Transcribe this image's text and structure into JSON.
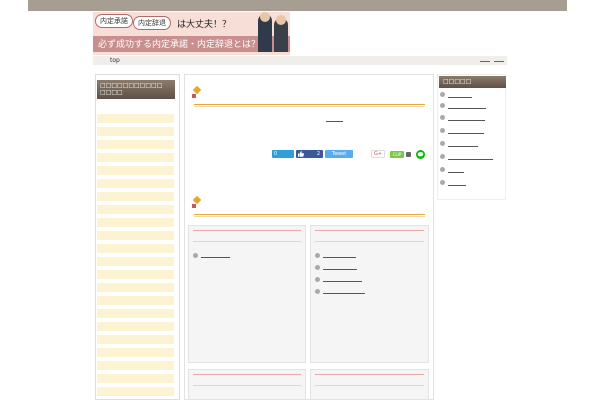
{
  "header": {
    "bubble1": "内定承諾",
    "bubble2": "内定辞退",
    "question": "は大丈夫！？",
    "tagline": "必ず成功する内定承諾・内定辞退とは？"
  },
  "nav": {
    "top_label": "top"
  },
  "sidebar_left": {
    "heading_line1": "□□□□□□□□□□□",
    "heading_line2": "□□□□"
  },
  "share": {
    "hatena_count": "0",
    "like_count": "2",
    "tweet_label": "Tweet",
    "gplus_label": "G+",
    "clip_label": "CLIP"
  },
  "sidebar_right": {
    "heading": "□□□□□"
  },
  "colors": {
    "accent_orange": "#e6a83e",
    "brown_header": "#6b5b4e",
    "sidebar_item_bg": "#fbf3d2",
    "twitter_blue": "#55acee",
    "facebook_blue": "#3b5998",
    "line_green": "#00b900"
  }
}
